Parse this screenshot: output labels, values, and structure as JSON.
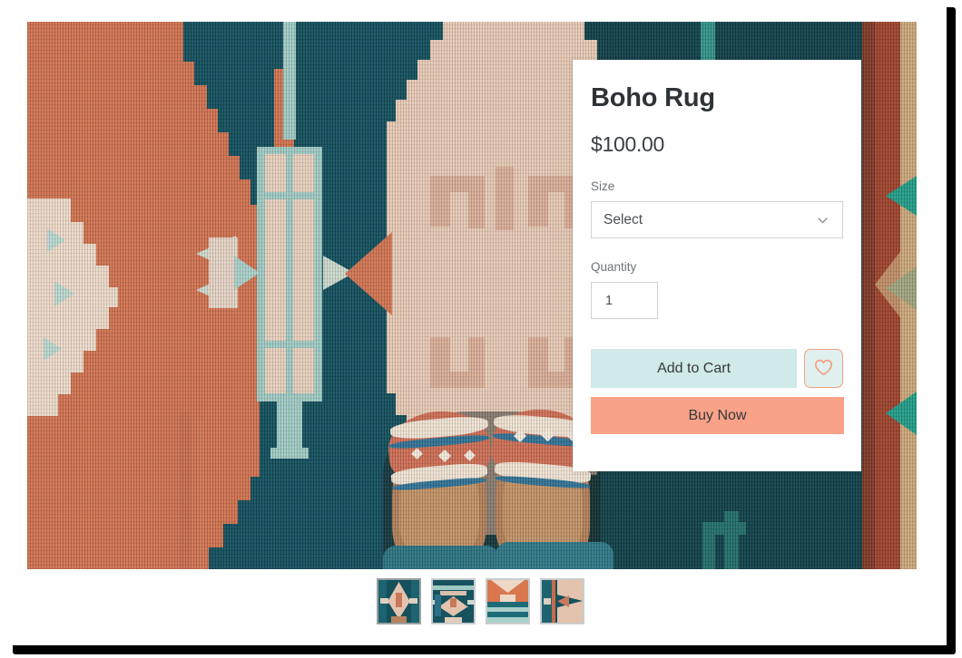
{
  "product": {
    "title": "Boho Rug",
    "price": "$100.00",
    "size": {
      "label": "Size",
      "selected": "Select",
      "placeholder": "Select",
      "chevron_icon": "chevron-down-icon"
    },
    "quantity": {
      "label": "Quantity",
      "value": "1"
    },
    "actions": {
      "add_to_cart": "Add to Cart",
      "buy_now": "Buy Now",
      "favorite_icon": "heart-icon"
    }
  },
  "gallery": {
    "hero_alt": "boho-kilim-rug-with-feet-in-slippers",
    "thumbnails": [
      {
        "name": "thumbnail-1",
        "active": true
      },
      {
        "name": "thumbnail-2",
        "active": false
      },
      {
        "name": "thumbnail-3",
        "active": false
      },
      {
        "name": "thumbnail-4",
        "active": false
      }
    ]
  },
  "colors": {
    "add_to_cart_bg": "#cfeae8",
    "buy_now_bg": "#f9a287",
    "favorite_border": "#f0a183",
    "favorite_bg": "#e0f0ee",
    "text_primary": "#2f3337",
    "text_muted": "#6f7478",
    "input_border": "#cfd2d4",
    "rug_terracotta": "#d4714d",
    "rug_teal": "#0f4f5e",
    "rug_cream": "#ecd5c3",
    "rug_mint": "#a9d4cc"
  }
}
